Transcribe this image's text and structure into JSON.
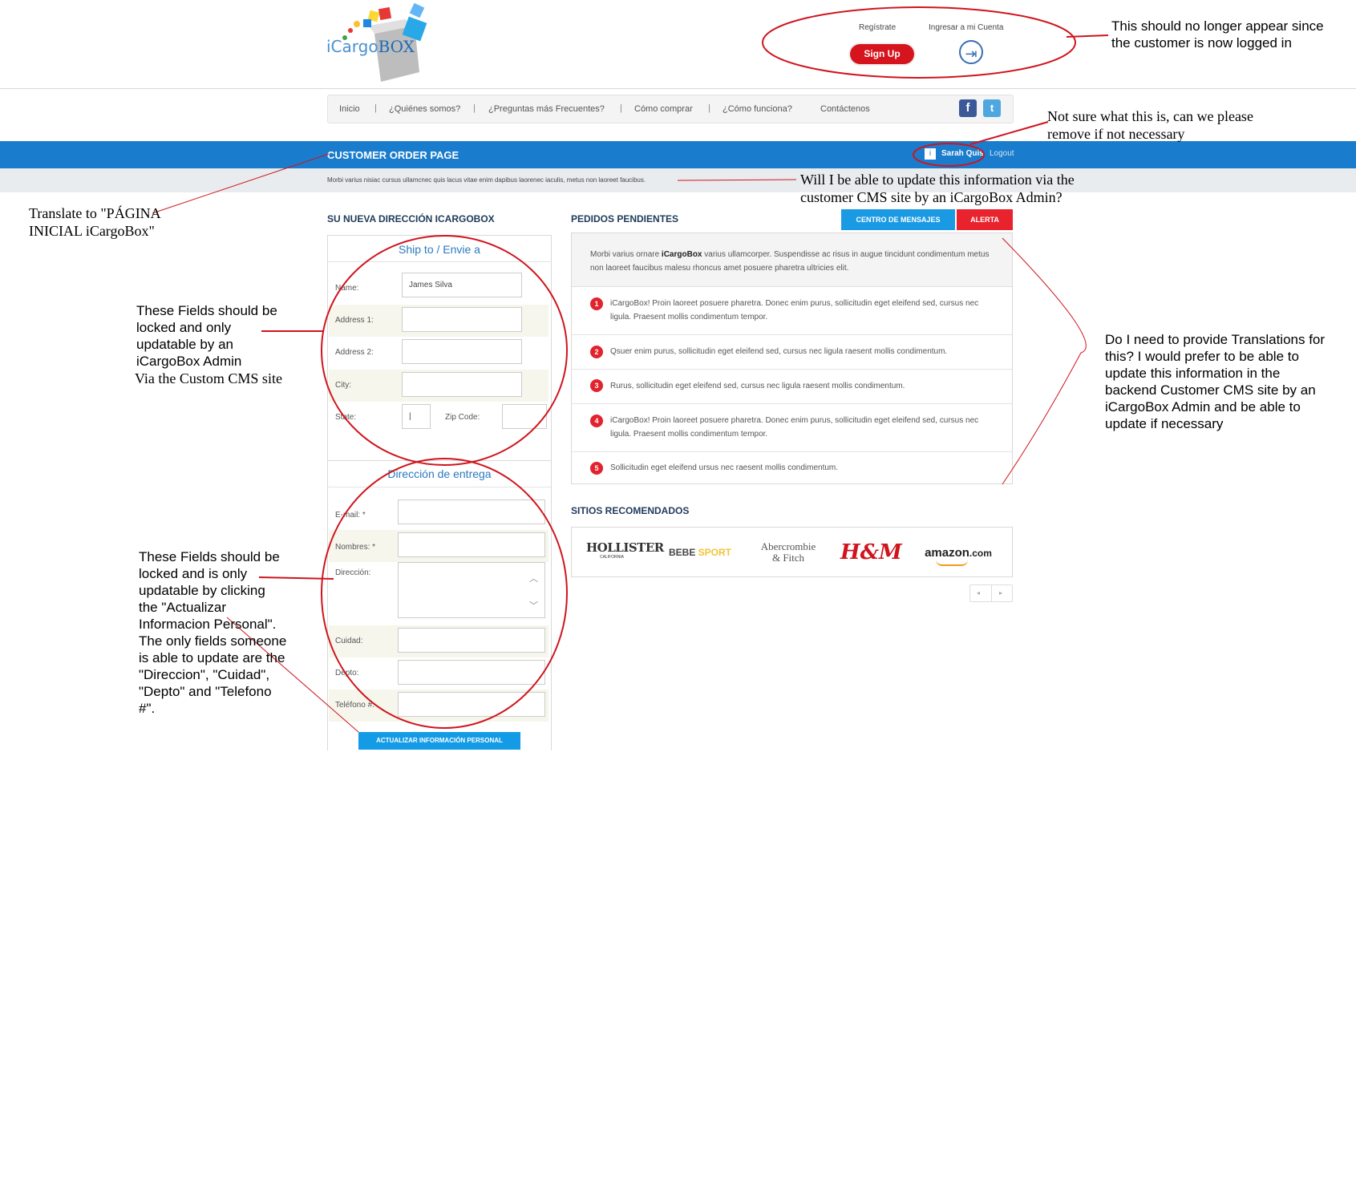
{
  "brand": {
    "logo_prefix": "iCargo",
    "logo_suffix": "BOX"
  },
  "header": {
    "register_label": "Regístrate",
    "login_label": "Ingresar a mi Cuenta",
    "signup_button": "Sign Up"
  },
  "nav": {
    "items": [
      "Inicio",
      "¿Quiénes somos?",
      "¿Preguntas más Frecuentes?",
      "Cómo comprar",
      "¿Cómo funciona?",
      "Contáctenos"
    ],
    "facebook_glyph": "f",
    "twitter_glyph": "t"
  },
  "bluebar": {
    "title": "CUSTOMER ORDER PAGE",
    "user_name": "Sarah Quis",
    "logout": "Logout",
    "user_glyph": "i"
  },
  "notice": {
    "text": "Morbi varius nisiac cursus ullamcnec quis lacus vitae enim dapibus laorenec iaculis, metus non laoreet faucibus."
  },
  "address_section": {
    "heading": "SU NUEVA DIRECCIÓN ICARGOBOX",
    "box_title": "Ship to / Envie a",
    "fields": {
      "name_label": "Name:",
      "name_value": "James Silva",
      "address1_label": "Address 1:",
      "address2_label": "Address 2:",
      "city_label": "City:",
      "state_label": "State:",
      "state_value": "|",
      "zip_label": "Zip Code:"
    }
  },
  "delivery_section": {
    "box_title": "Dirección de entrega",
    "fields": {
      "email_label": "E-mail: *",
      "nombres_label": "Nombres: *",
      "direccion_label": "Dirección:",
      "cuidad_label": "Cuidad:",
      "depto_label": "Depto:",
      "telefono_label": "Teléfono #:"
    },
    "update_button": "ACTUALIZAR INFORMACIÓN PERSONAL"
  },
  "orders_section": {
    "heading": "PEDIDOS PENDIENTES",
    "messages_button": "CENTRO DE MENSAJES",
    "alert_button": "ALERTA",
    "intro_pre": "Morbi varius ornare ",
    "intro_bold": "iCargoBox",
    "intro_post": " varius ullamcorper. Suspendisse ac risus in augue tincidunt condimentum metus non laoreet faucibus malesu rhoncus amet posuere pharetra ultricies elit.",
    "orders": [
      {
        "num": "1",
        "text": "iCargoBox! Proin laoreet posuere pharetra. Donec enim purus, sollicitudin eget eleifend sed, cursus nec ligula. Praesent mollis condimentum tempor."
      },
      {
        "num": "2",
        "text": "Qsuer enim purus, sollicitudin eget eleifend sed, cursus nec ligula raesent mollis condimentum."
      },
      {
        "num": "3",
        "text": "Rurus, sollicitudin eget eleifend sed, cursus nec ligula raesent mollis condimentum."
      },
      {
        "num": "4",
        "text": "iCargoBox! Proin laoreet posuere pharetra. Donec enim purus, sollicitudin eget eleifend sed, cursus nec ligula. Praesent mollis condimentum tempor."
      },
      {
        "num": "5",
        "text": "Sollicitudin eget eleifend ursus nec raesent mollis condimentum."
      }
    ]
  },
  "recommended": {
    "heading": "SITIOS RECOMENDADOS",
    "brands": {
      "hollister": "HOLLISTER",
      "hollister_sub": "CALIFORNIA",
      "bebe": "BEBE",
      "bebe_sport": "SPORT",
      "abercrombie_1": "Abercrombie",
      "abercrombie_2": "& Fitch",
      "hm": "H&M",
      "amazon": "amazon",
      "amazon_suffix": ".com"
    },
    "pager_prev": "◂",
    "pager_next": "▸"
  },
  "annotations": {
    "logged_in": "This should no longer appear since the customer is now logged in",
    "not_sure": "Not sure what this is, can we please remove if not necessary",
    "cms_update": "Will I be able to update this information via the customer CMS site by an iCargoBox Admin?",
    "translate": "Translate to \"PÁGINA INICIAL iCargoBox\"",
    "locked_admin_1": "These Fields should be locked and only updatable by an iCargoBox Admin",
    "locked_admin_2": "Via the Custom CMS site",
    "locked_update": "These Fields should be locked and is only updatable by clicking the \"Actualizar Informacion Personal\".  The only fields someone is able to update are the \"Direccion\", \"Cuidad\", \"Depto\" and \"Telefono #\".",
    "translations": "Do I need to provide Translations for this?  I would prefer to be able to update this information in the backend Customer CMS site by an   iCargoBox Admin and be able to update if necessary"
  },
  "colors": {
    "accent": "#1a7ccc",
    "alert": "#e8232e",
    "annotation": "#d0141d"
  }
}
